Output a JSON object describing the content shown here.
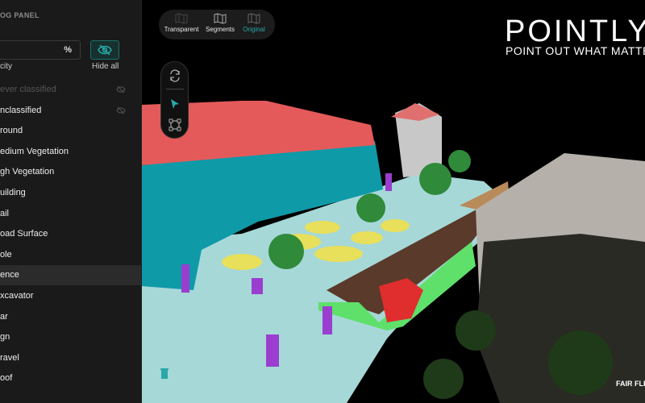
{
  "panel": {
    "title": "OG PANEL",
    "opacity_unit": "%",
    "opacity_label": "city",
    "hide_all_label": "Hide all",
    "items": [
      {
        "label": "ever classified",
        "dim": true,
        "eye": "eye-off-icon"
      },
      {
        "label": "nclassified",
        "eye": "eye-off-icon"
      },
      {
        "label": "round"
      },
      {
        "label": "edium Vegetation"
      },
      {
        "label": "gh Vegetation"
      },
      {
        "label": "uilding"
      },
      {
        "label": "ail"
      },
      {
        "label": "oad Surface"
      },
      {
        "label": "ole"
      },
      {
        "label": "ence",
        "selected": true
      },
      {
        "label": "xcavator"
      },
      {
        "label": "ar"
      },
      {
        "label": "gn"
      },
      {
        "label": "ravel"
      },
      {
        "label": "oof"
      }
    ]
  },
  "view_modes": [
    {
      "label": "Transparent"
    },
    {
      "label": "Segments"
    },
    {
      "label": "Original",
      "active": true
    }
  ],
  "tools": [
    "rotate-icon",
    "pointer-icon",
    "select-box-icon"
  ],
  "brand": {
    "name": "POINTLY",
    "tagline": "POINT OUT WHAT MATTER",
    "partner": "FAIR FLE"
  },
  "colors": {
    "accent": "#2aa7a9",
    "roof": "#e45a5a",
    "building": "#0f9aa8",
    "ground": "#a6d8d8",
    "medium_vegetation": "#e8df5a",
    "high_vegetation": "#2f8a3a",
    "pole": "#9a3ed0",
    "fence": "#5ee06a",
    "road_surface": "#5a3a2a"
  }
}
